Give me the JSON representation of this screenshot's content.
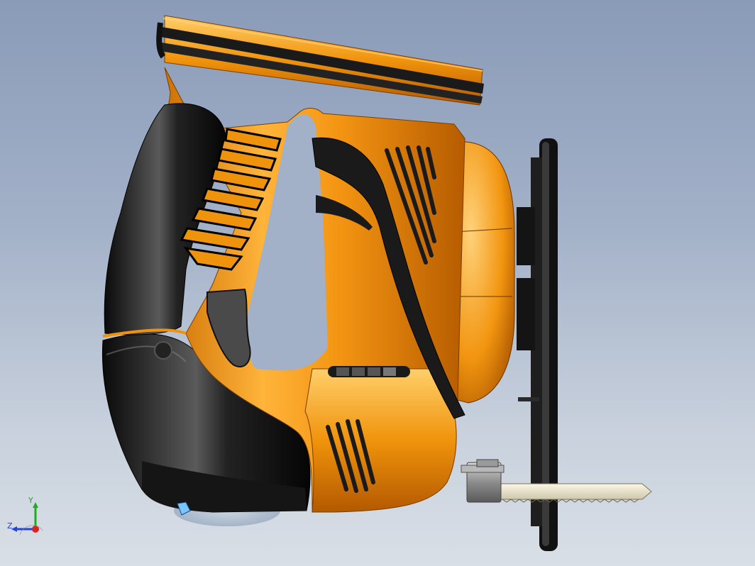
{
  "viewport": {
    "background_top": "#8a9bb8",
    "background_bottom": "#d9dfe6"
  },
  "model": {
    "name": "jigsaw",
    "body_color": "#f0930c",
    "grip_color": "#1c1c1c",
    "blade_color": "#e8e2cf",
    "shoe_color": "#1a1a1a"
  },
  "triad": {
    "y_label": "Y",
    "z_label": "Z",
    "y_color": "#22aa22",
    "z_color": "#2244dd",
    "x_color": "#dd2222"
  }
}
